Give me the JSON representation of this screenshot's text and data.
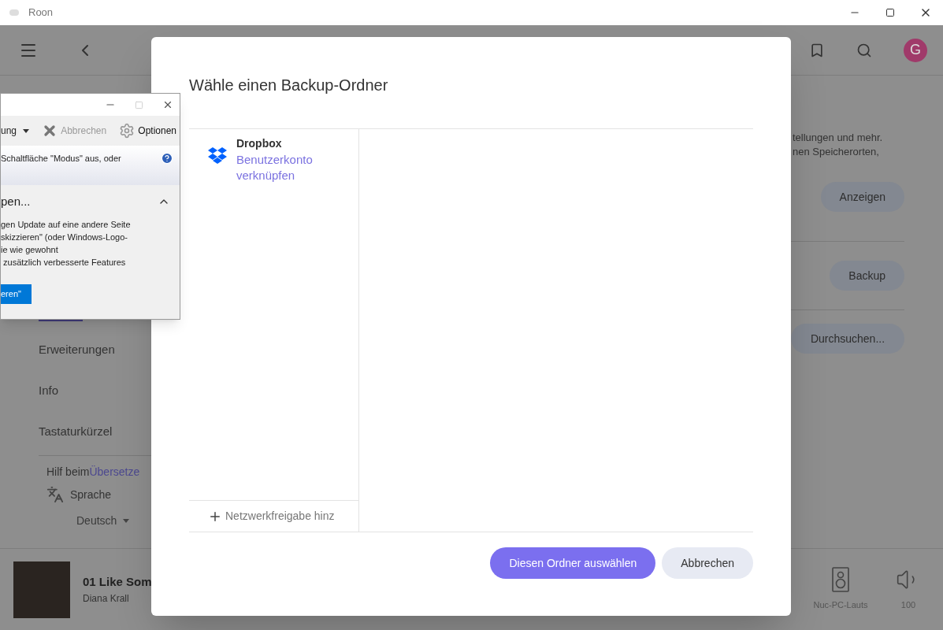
{
  "window": {
    "title": "Roon"
  },
  "header": {
    "avatar_letter": "G"
  },
  "nav": {
    "items": [
      {
        "label": "Erweiterungen"
      },
      {
        "label": "Info"
      },
      {
        "label": "Tastaturkürzel"
      }
    ],
    "translate_text": "Hilf beim ",
    "translate_link": "Übersetze",
    "language_label": "Sprache",
    "language_value": "Deutsch"
  },
  "content": {
    "text_lines": [
      "tellungen und mehr.",
      "nen Speicherorten,"
    ],
    "buttons": [
      "Anzeigen",
      "Backup",
      "Durchsuchen..."
    ]
  },
  "now_playing": {
    "title": "01 Like Som",
    "artist": "Diana Krall",
    "zone": "Nuc-PC-Lauts",
    "volume": "100"
  },
  "snip_window": {
    "toolbar": [
      {
        "kind": "dropdown",
        "label": "ung"
      },
      {
        "kind": "cancel",
        "label": "Abbrechen",
        "disabled": true
      },
      {
        "kind": "settings",
        "label": "Optionen"
      }
    ],
    "info": "Schaltfläche \"Modus\" aus, oder",
    "section": {
      "title": "pen...",
      "expanded": true,
      "lines": [
        "gen Update auf eine andere Seite",
        "skizzieren\" (oder Windows-Logo-",
        "ie wie gewohnt",
        " zusätzlich verbesserte Features"
      ],
      "button": "eren\""
    }
  },
  "dialog": {
    "title": "Wähle einen Backup-Ordner",
    "locations": [
      {
        "name": "Dropbox",
        "action": "Benutzerkonto verknüpfen"
      }
    ],
    "add_share": "Netzwerkfreigabe hinz",
    "buttons": [
      {
        "label": "Diesen Ordner auswählen",
        "primary": true
      },
      {
        "label": "Abbrechen",
        "primary": false
      }
    ]
  }
}
